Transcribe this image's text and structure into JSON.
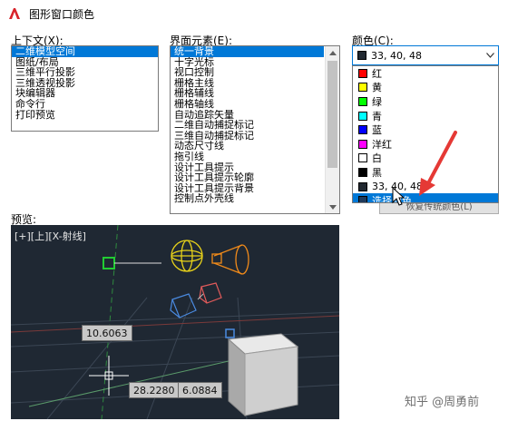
{
  "window": {
    "title": "图形窗口颜色"
  },
  "context": {
    "label": "上下文(X):",
    "items": [
      "二维模型空间",
      "图纸/布局",
      "三维平行投影",
      "三维透视投影",
      "块编辑器",
      "命令行",
      "打印预览"
    ],
    "selected_index": 0
  },
  "elements": {
    "label": "界面元素(E):",
    "items": [
      "统一背景",
      "十字光标",
      "视口控制",
      "栅格主线",
      "栅格辅线",
      "栅格轴线",
      "自动追踪矢量",
      "二维自动捕捉标记",
      "三维自动捕捉标记",
      "动态尺寸线",
      "拖引线",
      "设计工具提示",
      "设计工具提示轮廓",
      "设计工具提示背景",
      "控制点外壳线"
    ],
    "selected_index": 0
  },
  "color": {
    "label": "颜色(C):",
    "current": "33, 40, 48",
    "current_hex": "#212830",
    "options": [
      {
        "label": "红",
        "hex": "#ff0000"
      },
      {
        "label": "黄",
        "hex": "#ffff00"
      },
      {
        "label": "绿",
        "hex": "#00ff00"
      },
      {
        "label": "青",
        "hex": "#00ffff"
      },
      {
        "label": "蓝",
        "hex": "#0000ff"
      },
      {
        "label": "洋红",
        "hex": "#ff00ff"
      },
      {
        "label": "白",
        "hex": "#ffffff"
      },
      {
        "label": "黑",
        "hex": "#000000"
      },
      {
        "label": "33, 40, 48",
        "hex": "#212830"
      },
      {
        "label": "选择颜色...",
        "hex": "#1f3a5a"
      }
    ],
    "highlighted_index": 9,
    "restore_button": "恢复传统颜色(L)"
  },
  "preview": {
    "label": "预览:",
    "viewport_label": "[+][上][X-射线]",
    "dims": [
      "10.6063",
      "28.2280",
      "6.0884"
    ],
    "background_hex": "#1f2833"
  },
  "watermark": "知乎 @周勇前"
}
